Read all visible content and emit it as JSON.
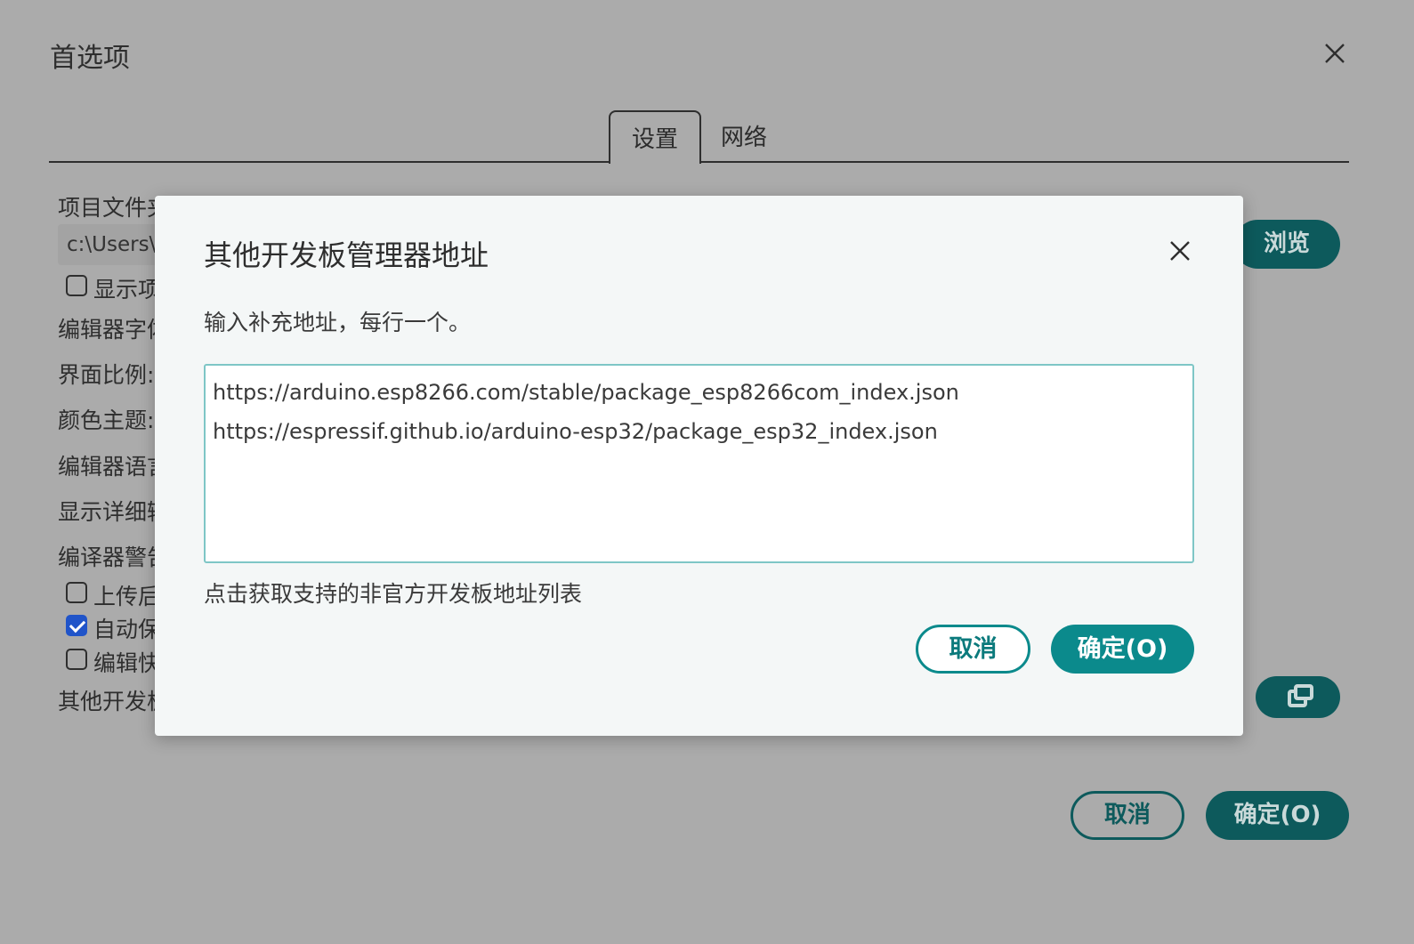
{
  "preferences": {
    "title": "首选项",
    "tabs": [
      {
        "label": "设置",
        "active": true
      },
      {
        "label": "网络",
        "active": false
      }
    ],
    "labels": {
      "sketchbook": "项目文件夹地址",
      "editor_font": "编辑器字体",
      "interface_scale": "界面比例:",
      "theme": "颜色主题:",
      "language": "编辑器语言",
      "verbose": "显示详细输出",
      "warnings": "编译器警告",
      "additional_urls": "其他开发板"
    },
    "sketchbook_path": "c:\\Users\\",
    "checkboxes": [
      {
        "label": "显示项",
        "checked": false
      },
      {
        "label": "上传后",
        "checked": false
      },
      {
        "label": "自动保",
        "checked": true
      },
      {
        "label": "编辑快",
        "checked": false
      }
    ],
    "browse_label": "浏览",
    "cancel_label": "取消",
    "ok_label": "确定(O)"
  },
  "dialog": {
    "title": "其他开发板管理器地址",
    "description": "输入补充地址，每行一个。",
    "urls": [
      "https://arduino.esp8266.com/stable/package_esp8266com_index.json",
      "https://espressif.github.io/arduino-esp32/package_esp32_index.json"
    ],
    "link_text": "点击获取支持的非官方开发板地址列表",
    "cancel_label": "取消",
    "ok_label": "确定(O)"
  },
  "colors": {
    "accent": "#0b8a8c",
    "accent_dimmed": "#0d5a5c",
    "overlay_bg": "#ababab",
    "dialog_bg": "#f4f7f7"
  }
}
